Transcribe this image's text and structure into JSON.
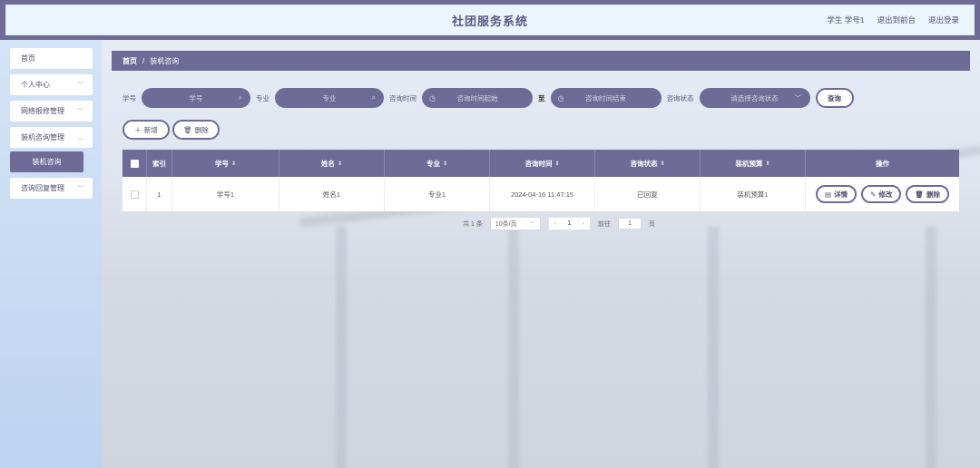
{
  "header": {
    "title": "社团服务系统",
    "user": "学生 学号1",
    "back_to_front": "退出到前台",
    "logout": "退出登录"
  },
  "sidebar": {
    "items": [
      {
        "label": "首页"
      },
      {
        "label": "个人中心"
      },
      {
        "label": "网络报修管理"
      },
      {
        "label": "装机咨询管理"
      },
      {
        "label": "装机咨询"
      },
      {
        "label": "咨询回复管理"
      }
    ]
  },
  "breadcrumb": {
    "home": "首页",
    "sep": "/",
    "current": "装机咨询"
  },
  "search": {
    "student_no_label": "学号",
    "student_no_placeholder": "学号",
    "major_label": "专业",
    "major_placeholder": "专业",
    "time_label": "咨询时间",
    "time_start_placeholder": "咨询时间起始",
    "time_sep": "至",
    "time_end_placeholder": "咨询时间结束",
    "status_label": "咨询状态",
    "status_placeholder": "请选择咨询状态",
    "query_button": "查询"
  },
  "actions": {
    "add": "新增",
    "delete": "删除"
  },
  "table": {
    "headers": [
      "",
      "索引",
      "学号",
      "姓名",
      "专业",
      "咨询时间",
      "咨询状态",
      "装机预算",
      "操作"
    ],
    "rows": [
      {
        "index": "1",
        "student_no": "学号1",
        "name": "姓名1",
        "major": "专业1",
        "time": "2024-04-16 11:47:15",
        "status": "已回复",
        "budget": "装机预算1"
      }
    ],
    "row_actions": {
      "detail": "详情",
      "edit": "修改",
      "delete": "删除"
    }
  },
  "pager": {
    "total": "共 1 条",
    "page_size": "10条/页",
    "current_page": "1",
    "goto_label": "前往",
    "goto_value": "1",
    "page_unit": "页"
  },
  "colors": {
    "primary": "#6e6b96",
    "header_bg": "#eaf5fc"
  }
}
